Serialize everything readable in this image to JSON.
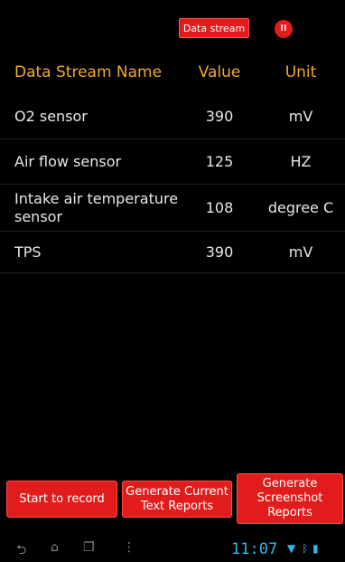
{
  "toolbar": {
    "data_stream_label": "Data stream",
    "pause_glyph": "II"
  },
  "table": {
    "headers": {
      "name": "Data Stream Name",
      "value": "Value",
      "unit": "Unit"
    },
    "rows": [
      {
        "name": "O2 sensor",
        "value": "390",
        "unit": "mV"
      },
      {
        "name": "Air flow sensor",
        "value": "125",
        "unit": "HZ"
      },
      {
        "name": "Intake air temperature sensor",
        "value": "108",
        "unit": "degree C"
      },
      {
        "name": "TPS",
        "value": "390",
        "unit": "mV"
      }
    ]
  },
  "actions": {
    "start_record": "Start to record",
    "text_reports": "Generate Current Text Reports",
    "screenshot_reports": "Generate Screenshot Reports"
  },
  "status_bar": {
    "time": "11:07"
  },
  "colors": {
    "accent_red": "#e21c1c",
    "header_orange": "#f0a92c",
    "clock_blue": "#35b5e5"
  },
  "icons": [
    "back-icon",
    "home-icon",
    "recent-apps-icon",
    "menu-icon",
    "wifi-icon",
    "bluetooth-icon",
    "battery-icon",
    "pause-icon"
  ]
}
